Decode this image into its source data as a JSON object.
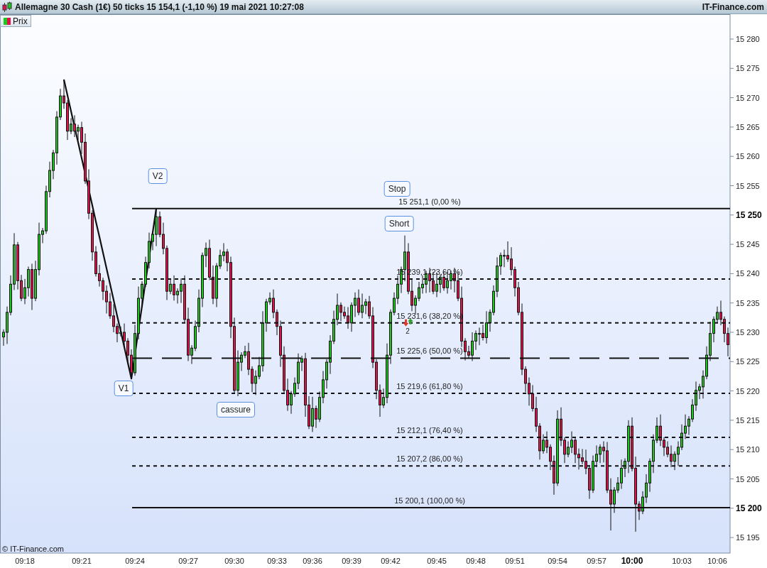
{
  "window": {
    "title": "Allemagne 30 Cash (1€) 50 ticks 15 154,1 (-1,10 %) 19 mai 2021 10:27:08",
    "brand": "IT-Finance.com"
  },
  "legend": [
    {
      "label": "Prix"
    }
  ],
  "chart": {
    "copyright": "© IT-Finance.com",
    "trade_marker": {
      "count": "2"
    },
    "bold_price_labels": [
      false,
      true,
      false,
      false,
      false,
      false,
      false,
      false,
      false,
      false,
      false,
      true,
      false,
      false,
      false,
      false,
      false,
      false
    ],
    "bold_time_labels": [
      false,
      false,
      false,
      false,
      false,
      false,
      false,
      false,
      false,
      false,
      false,
      false,
      false,
      false,
      true,
      false,
      false
    ],
    "chart_data": {
      "type": "candlestick",
      "ylim": [
        15192.35,
        15284.24
      ],
      "categories": [
        null,
        null,
        null,
        null,
        null,
        null,
        "09:18",
        null,
        null,
        null,
        null,
        null,
        null,
        null,
        null,
        null,
        null,
        null,
        null,
        null,
        null,
        null,
        "09:21",
        null,
        null,
        null,
        null,
        null,
        null,
        null,
        null,
        null,
        null,
        null,
        null,
        null,
        null,
        "09:24",
        null,
        null,
        null,
        null,
        null,
        null,
        null,
        null,
        null,
        null,
        null,
        null,
        null,
        null,
        "09:27",
        null,
        null,
        null,
        null,
        null,
        null,
        null,
        null,
        null,
        null,
        null,
        null,
        "09:30",
        null,
        null,
        null,
        null,
        null,
        null,
        null,
        null,
        null,
        null,
        null,
        "09:33",
        null,
        null,
        null,
        null,
        null,
        null,
        null,
        null,
        null,
        "09:36",
        null,
        null,
        null,
        null,
        null,
        null,
        null,
        null,
        null,
        null,
        "09:39",
        null,
        null,
        null,
        null,
        null,
        null,
        null,
        null,
        null,
        null,
        "09:42",
        null,
        null,
        null,
        null,
        null,
        null,
        null,
        null,
        null,
        null,
        null,
        null,
        "09:45",
        null,
        null,
        null,
        null,
        null,
        null,
        null,
        null,
        null,
        null,
        "09:48",
        null,
        null,
        null,
        null,
        null,
        null,
        null,
        null,
        null,
        null,
        "09:51",
        null,
        null,
        null,
        null,
        null,
        null,
        null,
        null,
        null,
        null,
        null,
        "09:54",
        null,
        null,
        null,
        null,
        null,
        null,
        null,
        null,
        null,
        null,
        "09:57",
        null,
        null,
        null,
        null,
        null,
        null,
        null,
        null,
        null,
        "10:00",
        null,
        null,
        null,
        null,
        null,
        null,
        null,
        null,
        null,
        null,
        null,
        null,
        null,
        "10:03",
        null,
        null,
        null,
        null,
        null,
        null,
        null,
        null,
        null,
        "10:06",
        null,
        null,
        null
      ],
      "ohlc": [
        [
          15229.2,
          15230.5,
          15227.7,
          15230.0
        ],
        [
          15230.0,
          15234.4,
          15228.0,
          15233.4
        ],
        [
          15233.4,
          15239.7,
          15232.9,
          15238.2
        ],
        [
          15238.2,
          15246.9,
          15237.2,
          15244.9
        ],
        [
          15244.9,
          15245.4,
          15237.3,
          15238.8
        ],
        [
          15238.8,
          15239.8,
          15235.3,
          15235.8
        ],
        [
          15235.8,
          15239.1,
          15234.8,
          15237.6
        ],
        [
          15237.6,
          15241.2,
          15236.1,
          15240.7
        ],
        [
          15240.7,
          15241.7,
          15233.8,
          15235.8
        ],
        [
          15235.8,
          15242.2,
          15235.3,
          15240.7
        ],
        [
          15240.7,
          15248.7,
          15239.7,
          15246.7
        ],
        [
          15246.7,
          15247.8,
          15245.2,
          15247.3
        ],
        [
          15247.3,
          15255.0,
          15246.8,
          15254.0
        ],
        [
          15254.0,
          15259.1,
          15253.0,
          15257.6
        ],
        [
          15257.6,
          15261.1,
          15256.1,
          15260.6
        ],
        [
          15260.6,
          15267.7,
          15258.6,
          15266.7
        ],
        [
          15266.7,
          15271.5,
          15266.2,
          15270.3
        ],
        [
          15270.3,
          15273.1,
          15268.1,
          15269.1
        ],
        [
          15269.1,
          15269.6,
          15262.8,
          15264.3
        ],
        [
          15264.3,
          15266.5,
          15263.8,
          15265.5
        ],
        [
          15265.5,
          15267.0,
          15263.3,
          15264.3
        ],
        [
          15264.3,
          15265.4,
          15262.8,
          15264.9
        ],
        [
          15264.9,
          15265.9,
          15260.4,
          15262.4
        ],
        [
          15262.4,
          15263.9,
          15255.3,
          15255.8
        ],
        [
          15255.8,
          15257.8,
          15249.3,
          15250.3
        ],
        [
          15250.3,
          15250.8,
          15242.2,
          15243.7
        ],
        [
          15243.7,
          15244.7,
          15239.5,
          15240.0
        ],
        [
          15240.0,
          15241.5,
          15237.8,
          15238.8
        ],
        [
          15238.8,
          15239.3,
          15235.5,
          15237.0
        ],
        [
          15237.0,
          15238.0,
          15233.2,
          15235.2
        ],
        [
          15235.2,
          15236.7,
          15232.3,
          15232.8
        ],
        [
          15232.8,
          15234.8,
          15230.0,
          15231.0
        ],
        [
          15231.0,
          15231.5,
          15228.3,
          15229.8
        ],
        [
          15229.8,
          15231.0,
          15229.3,
          15230.0
        ],
        [
          15230.0,
          15231.5,
          15227.5,
          15228.5
        ],
        [
          15228.5,
          15229.0,
          15224.6,
          15226.1
        ],
        [
          15226.1,
          15227.1,
          15222.1,
          15223.1
        ],
        [
          15223.1,
          15231.3,
          15222.6,
          15229.8
        ],
        [
          15229.8,
          15237.8,
          15228.8,
          15235.8
        ],
        [
          15235.8,
          15238.7,
          15234.3,
          15238.2
        ],
        [
          15238.2,
          15242.9,
          15237.7,
          15241.9
        ],
        [
          15241.9,
          15247.0,
          15240.9,
          15245.5
        ],
        [
          15245.5,
          15247.2,
          15244.0,
          15246.7
        ],
        [
          15246.7,
          15251.1,
          15244.7,
          15249.7
        ],
        [
          15249.7,
          15250.6,
          15246.2,
          15246.7
        ],
        [
          15246.7,
          15248.7,
          15243.3,
          15244.3
        ],
        [
          15244.3,
          15244.8,
          15235.5,
          15237.0
        ],
        [
          15237.0,
          15239.2,
          15236.5,
          15238.2
        ],
        [
          15238.2,
          15239.7,
          15235.4,
          15236.4
        ],
        [
          15236.4,
          15237.5,
          15234.9,
          15237.0
        ],
        [
          15237.0,
          15239.2,
          15235.0,
          15238.2
        ],
        [
          15238.2,
          15239.7,
          15231.7,
          15232.2
        ],
        [
          15232.2,
          15234.2,
          15225.1,
          15226.1
        ],
        [
          15226.1,
          15227.8,
          15224.6,
          15227.3
        ],
        [
          15227.3,
          15232.0,
          15226.8,
          15231.0
        ],
        [
          15231.0,
          15237.3,
          15230.0,
          15235.8
        ],
        [
          15235.8,
          15243.6,
          15234.3,
          15243.1
        ],
        [
          15243.1,
          15245.3,
          15241.1,
          15244.3
        ],
        [
          15244.3,
          15245.8,
          15238.9,
          15239.4
        ],
        [
          15239.4,
          15241.4,
          15234.8,
          15235.8
        ],
        [
          15235.8,
          15241.8,
          15234.3,
          15241.3
        ],
        [
          15241.3,
          15244.1,
          15240.8,
          15243.1
        ],
        [
          15243.1,
          15245.2,
          15242.1,
          15243.7
        ],
        [
          15243.7,
          15244.2,
          15240.4,
          15241.9
        ],
        [
          15241.9,
          15242.9,
          15229.0,
          15231.0
        ],
        [
          15231.0,
          15232.5,
          15219.6,
          15220.1
        ],
        [
          15220.1,
          15226.9,
          15219.1,
          15224.9
        ],
        [
          15224.9,
          15226.6,
          15223.4,
          15226.1
        ],
        [
          15226.1,
          15227.7,
          15225.6,
          15226.7
        ],
        [
          15226.7,
          15228.2,
          15222.7,
          15223.7
        ],
        [
          15223.7,
          15224.2,
          15219.8,
          15221.3
        ],
        [
          15221.3,
          15223.5,
          15219.3,
          15222.5
        ],
        [
          15222.5,
          15225.8,
          15222.0,
          15224.3
        ],
        [
          15224.3,
          15233.6,
          15223.3,
          15231.6
        ],
        [
          15231.6,
          15235.7,
          15230.1,
          15235.2
        ],
        [
          15235.2,
          15236.8,
          15234.7,
          15235.8
        ],
        [
          15235.8,
          15237.3,
          15232.4,
          15233.4
        ],
        [
          15233.4,
          15233.9,
          15229.5,
          15231.0
        ],
        [
          15231.0,
          15232.0,
          15224.1,
          15226.1
        ],
        [
          15226.1,
          15227.6,
          15219.6,
          15220.1
        ],
        [
          15220.1,
          15222.1,
          15216.6,
          15217.6
        ],
        [
          15217.6,
          15220.0,
          15216.1,
          15219.5
        ],
        [
          15219.5,
          15222.3,
          15219.0,
          15221.3
        ],
        [
          15221.3,
          15226.4,
          15220.3,
          15224.9
        ],
        [
          15224.9,
          15226.0,
          15223.4,
          15225.5
        ],
        [
          15225.5,
          15226.5,
          15215.6,
          15217.6
        ],
        [
          15217.6,
          15219.1,
          15213.5,
          15214.0
        ],
        [
          15214.0,
          15219.0,
          15213.0,
          15217.0
        ],
        [
          15217.0,
          15217.5,
          15213.7,
          15215.2
        ],
        [
          15215.2,
          15219.9,
          15214.7,
          15218.9
        ],
        [
          15218.9,
          15223.4,
          15217.9,
          15221.9
        ],
        [
          15221.9,
          15225.4,
          15220.4,
          15224.9
        ],
        [
          15224.9,
          15229.5,
          15222.9,
          15228.5
        ],
        [
          15228.5,
          15233.7,
          15228.0,
          15232.2
        ],
        [
          15232.2,
          15236.6,
          15231.2,
          15234.6
        ],
        [
          15234.6,
          15235.1,
          15231.9,
          15233.4
        ],
        [
          15233.4,
          15234.4,
          15232.3,
          15232.8
        ],
        [
          15232.8,
          15234.3,
          15230.6,
          15231.6
        ],
        [
          15231.6,
          15235.1,
          15230.1,
          15234.6
        ],
        [
          15234.6,
          15236.8,
          15232.6,
          15235.8
        ],
        [
          15235.8,
          15237.3,
          15232.9,
          15233.4
        ],
        [
          15233.4,
          15236.6,
          15232.4,
          15234.6
        ],
        [
          15234.6,
          15235.7,
          15233.1,
          15235.2
        ],
        [
          15235.2,
          15236.2,
          15232.3,
          15232.8
        ],
        [
          15232.8,
          15234.3,
          15223.9,
          15224.9
        ],
        [
          15224.9,
          15225.4,
          15218.6,
          15220.1
        ],
        [
          15220.1,
          15221.1,
          15215.6,
          15217.6
        ],
        [
          15217.6,
          15220.4,
          15217.1,
          15218.9
        ],
        [
          15218.9,
          15228.1,
          15217.9,
          15226.1
        ],
        [
          15226.1,
          15233.9,
          15224.6,
          15233.4
        ],
        [
          15233.4,
          15236.8,
          15232.9,
          15235.8
        ],
        [
          15235.8,
          15239.7,
          15234.8,
          15238.2
        ],
        [
          15238.2,
          15241.2,
          15236.7,
          15240.7
        ],
        [
          15240.7,
          15246.5,
          15238.7,
          15243.7
        ],
        [
          15243.7,
          15245.2,
          15236.5,
          15237.0
        ],
        [
          15237.0,
          15239.0,
          15233.6,
          15234.6
        ],
        [
          15234.6,
          15236.3,
          15233.1,
          15235.8
        ],
        [
          15235.8,
          15238.6,
          15235.3,
          15237.6
        ],
        [
          15237.6,
          15239.7,
          15236.6,
          15238.2
        ],
        [
          15238.2,
          15240.5,
          15236.7,
          15240.0
        ],
        [
          15240.0,
          15241.0,
          15236.8,
          15238.8
        ],
        [
          15238.8,
          15240.3,
          15236.5,
          15237.0
        ],
        [
          15237.0,
          15240.2,
          15236.0,
          15238.2
        ],
        [
          15238.2,
          15239.9,
          15236.7,
          15239.4
        ],
        [
          15239.4,
          15240.4,
          15237.1,
          15237.6
        ],
        [
          15237.6,
          15240.3,
          15236.6,
          15238.8
        ],
        [
          15238.8,
          15240.5,
          15237.3,
          15240.0
        ],
        [
          15240.0,
          15241.0,
          15236.8,
          15238.8
        ],
        [
          15238.8,
          15240.3,
          15235.3,
          15235.8
        ],
        [
          15235.8,
          15237.8,
          15227.5,
          15228.5
        ],
        [
          15228.5,
          15229.0,
          15225.2,
          15226.7
        ],
        [
          15226.7,
          15227.7,
          15225.6,
          15226.1
        ],
        [
          15226.1,
          15230.0,
          15225.1,
          15228.5
        ],
        [
          15228.5,
          15230.3,
          15227.0,
          15229.8
        ],
        [
          15229.8,
          15230.8,
          15227.8,
          15229.8
        ],
        [
          15229.8,
          15231.3,
          15228.6,
          15229.1
        ],
        [
          15229.1,
          15233.6,
          15228.1,
          15231.6
        ],
        [
          15231.6,
          15233.9,
          15230.1,
          15233.4
        ],
        [
          15233.4,
          15238.0,
          15232.9,
          15237.0
        ],
        [
          15237.0,
          15242.8,
          15236.0,
          15241.3
        ],
        [
          15241.3,
          15243.6,
          15239.8,
          15243.1
        ],
        [
          15243.1,
          15244.1,
          15241.1,
          15243.1
        ],
        [
          15243.1,
          15245.5,
          15242.0,
          15242.5
        ],
        [
          15242.5,
          15244.5,
          15239.7,
          15240.7
        ],
        [
          15240.7,
          15241.2,
          15236.1,
          15237.6
        ],
        [
          15237.6,
          15238.6,
          15232.9,
          15233.4
        ],
        [
          15233.4,
          15234.9,
          15222.7,
          15223.7
        ],
        [
          15223.7,
          15224.2,
          15219.8,
          15221.3
        ],
        [
          15221.3,
          15222.3,
          15217.5,
          15219.5
        ],
        [
          15219.5,
          15221.0,
          15216.5,
          15217.0
        ],
        [
          15217.0,
          15219.0,
          15213.0,
          15214.0
        ],
        [
          15214.0,
          15214.5,
          15208.3,
          15209.8
        ],
        [
          15209.8,
          15212.6,
          15209.3,
          15211.6
        ],
        [
          15211.6,
          15213.1,
          15209.4,
          15210.4
        ],
        [
          15210.4,
          15210.9,
          15206.5,
          15208.0
        ],
        [
          15208.0,
          15209.0,
          15202.3,
          15204.3
        ],
        [
          15204.3,
          15216.7,
          15203.8,
          15215.2
        ],
        [
          15215.2,
          15217.2,
          15210.6,
          15211.6
        ],
        [
          15211.6,
          15212.1,
          15207.7,
          15209.2
        ],
        [
          15209.2,
          15211.4,
          15208.7,
          15210.4
        ],
        [
          15210.4,
          15213.1,
          15209.4,
          15211.6
        ],
        [
          15211.6,
          15212.1,
          15207.7,
          15209.2
        ],
        [
          15209.2,
          15210.2,
          15206.6,
          15208.6
        ],
        [
          15208.6,
          15210.1,
          15207.5,
          15208.0
        ],
        [
          15208.0,
          15210.0,
          15205.8,
          15206.8
        ],
        [
          15206.8,
          15207.3,
          15201.6,
          15203.1
        ],
        [
          15203.1,
          15209.0,
          15202.6,
          15208.0
        ],
        [
          15208.0,
          15210.7,
          15207.0,
          15209.2
        ],
        [
          15209.2,
          15210.9,
          15207.7,
          15210.4
        ],
        [
          15210.4,
          15211.4,
          15207.8,
          15209.8
        ],
        [
          15209.8,
          15211.3,
          15202.6,
          15203.1
        ],
        [
          15203.1,
          15205.1,
          15196.2,
          15200.7
        ],
        [
          15200.7,
          15203.6,
          15199.2,
          15203.1
        ],
        [
          15203.1,
          15205.3,
          15202.6,
          15204.3
        ],
        [
          15204.3,
          15208.3,
          15203.3,
          15206.8
        ],
        [
          15206.8,
          15208.5,
          15205.3,
          15208.0
        ],
        [
          15208.0,
          15215.0,
          15206.0,
          15214.0
        ],
        [
          15214.0,
          15215.5,
          15206.3,
          15206.8
        ],
        [
          15206.8,
          15208.8,
          15196.0,
          15200.7
        ],
        [
          15200.7,
          15201.2,
          15198.0,
          15199.5
        ],
        [
          15199.5,
          15202.9,
          15199.0,
          15201.9
        ],
        [
          15201.9,
          15205.8,
          15200.9,
          15204.3
        ],
        [
          15204.3,
          15208.5,
          15202.8,
          15208.0
        ],
        [
          15208.0,
          15212.6,
          15206.0,
          15211.6
        ],
        [
          15211.6,
          15215.5,
          15211.1,
          15214.0
        ],
        [
          15214.0,
          15216.0,
          15210.6,
          15211.6
        ],
        [
          15211.6,
          15212.1,
          15208.9,
          15210.4
        ],
        [
          15210.4,
          15211.4,
          15208.7,
          15209.2
        ],
        [
          15209.2,
          15210.7,
          15207.0,
          15208.0
        ],
        [
          15208.0,
          15209.7,
          15206.5,
          15209.2
        ],
        [
          15209.2,
          15211.4,
          15207.2,
          15210.4
        ],
        [
          15210.4,
          15214.3,
          15209.9,
          15212.8
        ],
        [
          15212.8,
          15216.0,
          15211.8,
          15214.0
        ],
        [
          15214.0,
          15215.7,
          15212.5,
          15215.2
        ],
        [
          15215.2,
          15218.6,
          15214.7,
          15217.6
        ],
        [
          15217.6,
          15221.6,
          15216.6,
          15220.1
        ],
        [
          15220.1,
          15221.2,
          15218.6,
          15220.7
        ],
        [
          15220.7,
          15223.5,
          15218.7,
          15222.5
        ],
        [
          15222.5,
          15227.6,
          15222.0,
          15226.1
        ],
        [
          15226.1,
          15231.8,
          15225.1,
          15229.8
        ],
        [
          15229.8,
          15232.7,
          15228.3,
          15232.2
        ],
        [
          15232.2,
          15234.4,
          15231.7,
          15233.4
        ],
        [
          15233.4,
          15235.4,
          15231.2,
          15232.2
        ],
        [
          15232.2,
          15232.7,
          15228.3,
          15229.8
        ],
        [
          15229.8,
          15230.8,
          15225.9,
          15227.9
        ]
      ],
      "series": [
        {
          "type": "line",
          "values": [
            null,
            null,
            null,
            null,
            null,
            null,
            null,
            null,
            null,
            null,
            null,
            null,
            null,
            null,
            null,
            null,
            null,
            15273.1,
            15270.4,
            15267.7,
            15265.0,
            15262.4,
            15259.7,
            15257.0,
            15254.3,
            15251.6,
            15248.9,
            15246.3,
            15243.6,
            15240.9,
            15238.2,
            15235.5,
            15232.8,
            15230.2,
            15227.5,
            15224.8,
            15222.1,
            15226.2,
            15230.4,
            15234.5,
            15238.7,
            15242.8,
            15247.0,
            15251.1,
            null,
            null,
            null,
            null,
            null,
            null,
            null,
            null,
            null,
            null,
            null,
            null,
            null,
            null,
            null,
            null,
            null,
            null,
            null,
            null,
            null,
            null,
            null,
            null,
            null,
            null,
            null,
            null,
            null,
            null,
            null,
            null,
            null,
            null,
            null,
            null,
            null,
            null,
            null,
            null,
            null,
            null,
            null,
            null,
            null,
            null,
            null,
            null,
            null,
            null,
            null,
            null,
            null,
            null,
            null,
            null,
            null,
            null,
            null,
            null,
            null,
            null,
            null,
            null,
            null,
            null,
            null,
            null,
            null,
            null,
            null,
            null,
            null,
            null,
            null,
            null,
            null,
            null,
            null,
            null,
            null,
            null,
            null,
            null,
            null,
            null,
            null,
            null,
            null,
            null,
            null,
            null,
            null,
            null,
            null,
            null,
            null,
            null,
            null,
            null,
            null,
            null,
            null,
            null,
            null,
            null,
            null,
            null,
            null,
            null,
            null,
            null,
            null,
            null,
            null,
            null,
            null,
            null,
            null,
            null,
            null,
            null,
            null,
            null,
            null,
            null,
            null,
            null,
            null,
            null,
            null,
            null,
            null,
            null,
            null,
            null,
            null,
            null,
            null,
            null,
            null,
            null,
            null,
            null,
            null,
            null,
            null,
            null,
            null,
            null,
            null,
            null,
            null,
            null,
            null,
            null,
            null,
            null,
            null,
            null,
            null
          ]
        }
      ],
      "yticks": [
        {
          "value": 15195,
          "label": "15 195"
        },
        {
          "value": 15200,
          "label": "15 200"
        },
        {
          "value": 15205,
          "label": "15 205"
        },
        {
          "value": 15210,
          "label": "15 210"
        },
        {
          "value": 15215,
          "label": "15 215"
        },
        {
          "value": 15220,
          "label": "15 220"
        },
        {
          "value": 15225,
          "label": "15 225"
        },
        {
          "value": 15230,
          "label": "15 230"
        },
        {
          "value": 15235,
          "label": "15 235"
        },
        {
          "value": 15240,
          "label": "15 240"
        },
        {
          "value": 15245,
          "label": "15 245"
        },
        {
          "value": 15250,
          "label": "15 250"
        },
        {
          "value": 15255,
          "label": "15 255"
        },
        {
          "value": 15260,
          "label": "15 260"
        },
        {
          "value": 15265,
          "label": "15 265"
        },
        {
          "value": 15270,
          "label": "15 270"
        },
        {
          "value": 15275,
          "label": "15 275"
        },
        {
          "value": 15280,
          "label": "15 280"
        }
      ],
      "ref_lines": [
        {
          "axis": "y",
          "value": 15251.1,
          "label": "15 251,1 (0,00 %)"
        },
        {
          "axis": "y",
          "value": 15239.1,
          "label": "15 239,1 (23,60 %)"
        },
        {
          "axis": "y",
          "value": 15231.6,
          "label": "15 231,6 (38,20 %)"
        },
        {
          "axis": "y",
          "value": 15225.6,
          "label": "15 225,6 (50,00 %)"
        },
        {
          "axis": "y",
          "value": 15219.6,
          "label": "15 219,6 (61,80 %)"
        },
        {
          "axis": "y",
          "value": 15212.1,
          "label": "15 212,1 (76,40 %)"
        },
        {
          "axis": "y",
          "value": 15207.2,
          "label": "15 207,2 (86,00 %)"
        },
        {
          "axis": "y",
          "value": 15200.1,
          "label": "15 200,1 (100,00 %)"
        }
      ],
      "annotations": [
        "V1",
        "V2",
        "cassure",
        "Stop",
        "Short"
      ]
    }
  }
}
